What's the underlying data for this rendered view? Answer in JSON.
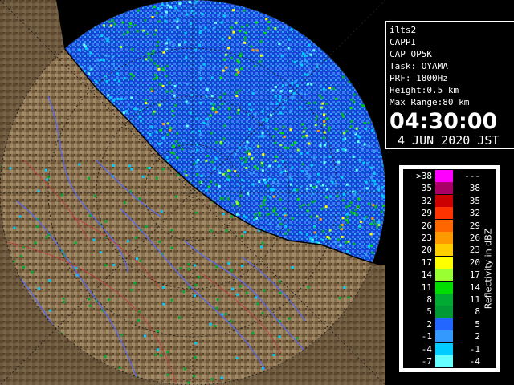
{
  "info": {
    "lines": [
      "ilts2",
      "CAPPI",
      "CAP_OP5K",
      "Task: OYAMA",
      "PRF: 1800Hz",
      "Height:0.5 km",
      "Max Range:80 km"
    ],
    "time": "04:30:00",
    "date": "4 JUN 2020 JST"
  },
  "legend": {
    "title": "Reflectivity in dBZ",
    "rows": [
      {
        "lo": ">38",
        "hi": "---",
        "color": "#ff00ff"
      },
      {
        "lo": "35",
        "hi": "38",
        "color": "#aa0066"
      },
      {
        "lo": "32",
        "hi": "35",
        "color": "#cc0000"
      },
      {
        "lo": "29",
        "hi": "32",
        "color": "#ff3300"
      },
      {
        "lo": "26",
        "hi": "29",
        "color": "#ff6600"
      },
      {
        "lo": "23",
        "hi": "26",
        "color": "#ff9900"
      },
      {
        "lo": "20",
        "hi": "23",
        "color": "#ffcc00"
      },
      {
        "lo": "17",
        "hi": "20",
        "color": "#ffff00"
      },
      {
        "lo": "14",
        "hi": "17",
        "color": "#99ff33"
      },
      {
        "lo": "11",
        "hi": "14",
        "color": "#00dd00"
      },
      {
        "lo": "8",
        "hi": "11",
        "color": "#00aa33"
      },
      {
        "lo": "5",
        "hi": "8",
        "color": "#009933"
      },
      {
        "lo": "2",
        "hi": "5",
        "color": "#2266ff"
      },
      {
        "lo": "-1",
        "hi": "2",
        "color": "#3399ff"
      },
      {
        "lo": "-4",
        "hi": "-1",
        "color": "#00ccff"
      },
      {
        "lo": "-7",
        "hi": "-4",
        "color": "#66ffff"
      }
    ]
  },
  "colors": {
    "radar_background": "#0033cc",
    "terrain": "#8a7050",
    "sea_outside": "#000000",
    "coastline": "#000000",
    "rivers": "#5060ff",
    "roads": "#cc3333",
    "grid": "#202020"
  },
  "map": {
    "range_rings": [
      "20 km",
      "40 km",
      "60 km",
      "80 km"
    ]
  }
}
